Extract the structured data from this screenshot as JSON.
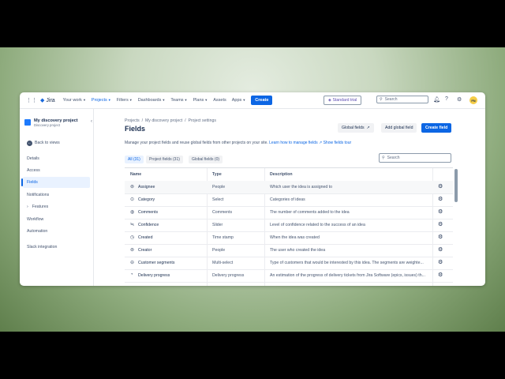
{
  "topbar": {
    "logo": "Jira",
    "nav": [
      {
        "label": "Your work",
        "active": false
      },
      {
        "label": "Projects",
        "active": true
      },
      {
        "label": "Filters",
        "active": false
      },
      {
        "label": "Dashboards",
        "active": false
      },
      {
        "label": "Teams",
        "active": false
      },
      {
        "label": "Plans",
        "active": false
      },
      {
        "label": "Assets",
        "active": false
      },
      {
        "label": "Apps",
        "active": false
      }
    ],
    "create_label": "Create",
    "trial_label": "Standard trial",
    "search_placeholder": "Search",
    "avatar_initials": "FN"
  },
  "sidebar": {
    "project_name": "My discovery project",
    "project_type": "Discovery project",
    "back_label": "Back to views",
    "items": [
      "Details",
      "Access",
      "Fields",
      "Notifications",
      "Features",
      "Workflow",
      "Automation",
      "Slack integration"
    ],
    "active_item": "Fields"
  },
  "main": {
    "breadcrumbs": [
      "Projects",
      "My discovery project",
      "Project settings"
    ],
    "title": "Fields",
    "global_fields_label": "Global fields",
    "add_global_label": "Add global field",
    "create_field_label": "Create field",
    "description": "Manage your project fields and reuse global fields from other projects on your site.",
    "learn_link": "Learn how to manage fields",
    "tour_link": "Show fields tour",
    "filters": [
      "All (31)",
      "Project fields (31)",
      "Global fields (0)"
    ],
    "search_placeholder": "Search",
    "columns": [
      "Name",
      "Type",
      "Description"
    ],
    "rows": [
      {
        "icon": "assignee-icon",
        "name": "Assignee",
        "type": "People",
        "description": "Which user the idea is assigned to"
      },
      {
        "icon": "select-icon",
        "name": "Category",
        "type": "Select",
        "description": "Categories of ideas"
      },
      {
        "icon": "comments-icon",
        "name": "Comments",
        "type": "Comments",
        "description": "The number of comments added to the idea"
      },
      {
        "icon": "slider-icon",
        "name": "Confidence",
        "type": "Slider",
        "description": "Level of confidence related to the success of an idea"
      },
      {
        "icon": "clock-icon",
        "name": "Created",
        "type": "Time stamp",
        "description": "When the idea was created"
      },
      {
        "icon": "people-icon",
        "name": "Creator",
        "type": "People",
        "description": "The user who created the idea"
      },
      {
        "icon": "multiselect-icon",
        "name": "Customer segments",
        "type": "Multi-select",
        "description": "Type of customers that would be interested by this idea. The segments are weighte..."
      },
      {
        "icon": "progress-icon",
        "name": "Delivery progress",
        "type": "Delivery progress",
        "description": "An estimation of the progress of delivery tickets from Jira Software (epics, issues) th..."
      }
    ]
  },
  "colors": {
    "accent": "#0c66e4",
    "trial": "#5e4db2",
    "avatar": "#f5cd47"
  }
}
